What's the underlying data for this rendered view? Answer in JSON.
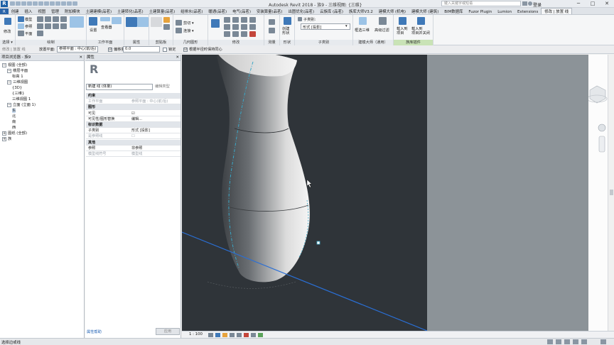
{
  "titlebar": {
    "logo": "R",
    "app_title": "Autodesk Revit 2018 -    族9 - 三维视图: {三维}",
    "search_placeholder": "键入关键字或短语",
    "login": "登录",
    "minimize": "─",
    "maximize": "□",
    "close": "✕"
  },
  "tabs": [
    {
      "label": "R",
      "active": false,
      "file": true
    },
    {
      "label": "创建",
      "active": false
    },
    {
      "label": "插入",
      "active": false
    },
    {
      "label": "视图",
      "active": false
    },
    {
      "label": "管理",
      "active": false
    },
    {
      "label": "附加模块",
      "active": false
    },
    {
      "label": "土建建模(品茗)",
      "active": false
    },
    {
      "label": "土建转化(品茗)",
      "active": false
    },
    {
      "label": "土建算量(品茗)",
      "active": false
    },
    {
      "label": "给排水(品茗)",
      "active": false
    },
    {
      "label": "暖通(品茗)",
      "active": false
    },
    {
      "label": "电气(品茗)",
      "active": false
    },
    {
      "label": "安装算量(品茗)",
      "active": false
    },
    {
      "label": "出图优化(品茗)",
      "active": false
    },
    {
      "label": "云族库 (品茗)",
      "active": false
    },
    {
      "label": "族库大师V3.2",
      "active": false
    },
    {
      "label": "建模大师 (机电)",
      "active": false
    },
    {
      "label": "建模大师 (建筑)",
      "active": false
    },
    {
      "label": "BIM数据库",
      "active": false
    },
    {
      "label": "Fuzor Plugin",
      "active": false
    },
    {
      "label": "Lumion",
      "active": false
    },
    {
      "label": "Extensions",
      "active": false
    },
    {
      "label": "修改 | 放置 线",
      "active": true
    }
  ],
  "ribbon": {
    "groups": {
      "select": "选择 ▾",
      "properties": "属性",
      "clipboard": "剪贴板",
      "geometry": "几何图形",
      "modify": "修改",
      "measure": "测量",
      "create": "创建",
      "form": "形状",
      "subcategory": "子类别",
      "jianmo": "建模大师（通用）",
      "zuku": "族库插件"
    },
    "labels": {
      "modify_btn": "修改",
      "model": "模型",
      "reference": "参照",
      "plane": "平面",
      "draw": "绘制",
      "set": "设置",
      "viewer": "查看器",
      "workplane": "工作平面",
      "cut": "剪切 ▾",
      "join": "连接 ▾",
      "create_form": "创建\n形状",
      "subcategory_label": "子类别:",
      "subcategory_value": "形式 [投影]",
      "filter3d": "框选三维",
      "advfilter": "高级过滤",
      "load_project": "载入到\n项目",
      "load_close": "载入到\n项目并关闭"
    }
  },
  "optbar": {
    "mode": "修改 | 放置 线",
    "plane_label": "放置平面:",
    "plane_value": "参照平面 : 中心(前/后)",
    "offset_label": "偏移量:",
    "offset_value": "0.0",
    "lock_label": "锁定",
    "chain_label": "链",
    "radius_label": "根据半径时保持同心"
  },
  "browser": {
    "title": "项目浏览器 - 族9",
    "items": [
      {
        "label": "视图 (全部)",
        "indent": 0,
        "exp": "−"
      },
      {
        "label": "楼层平面",
        "indent": 1,
        "exp": "−"
      },
      {
        "label": "标高 1",
        "indent": 2,
        "exp": ""
      },
      {
        "label": "三维视图",
        "indent": 1,
        "exp": "−"
      },
      {
        "label": "{3D}",
        "indent": 2,
        "exp": ""
      },
      {
        "label": "{三维}",
        "indent": 2,
        "exp": ""
      },
      {
        "label": "三维视图 1",
        "indent": 2,
        "exp": ""
      },
      {
        "label": "立面 (立面 1)",
        "indent": 1,
        "exp": "−"
      },
      {
        "label": "东",
        "indent": 2,
        "exp": "",
        "selected": true
      },
      {
        "label": "北",
        "indent": 2,
        "exp": ""
      },
      {
        "label": "南",
        "indent": 2,
        "exp": ""
      },
      {
        "label": "西",
        "indent": 2,
        "exp": ""
      },
      {
        "label": "图纸 (全部)",
        "indent": 0,
        "exp": "+"
      },
      {
        "label": "族",
        "indent": 0,
        "exp": "+"
      }
    ]
  },
  "properties": {
    "title": "属性",
    "logo": "R",
    "type_selector": "新建 线 (体量)",
    "edit_type": "编辑类型",
    "rows": [
      {
        "k": "约束",
        "v": "",
        "cat": true
      },
      {
        "k": "工作平面",
        "v": "参照平面 : 中心(前/后)",
        "grey": true
      },
      {
        "k": "图形",
        "v": "",
        "cat": true
      },
      {
        "k": "可见",
        "v": "☑"
      },
      {
        "k": "可见性/图形替换",
        "v": "编辑..."
      },
      {
        "k": "标识数据",
        "v": "",
        "cat": true
      },
      {
        "k": "子类别",
        "v": "形式 [投影]"
      },
      {
        "k": "是参照线",
        "v": "☐",
        "grey": true
      },
      {
        "k": "其他",
        "v": "",
        "cat": true
      },
      {
        "k": "参照",
        "v": "非参照"
      },
      {
        "k": "模型线符号",
        "v": "模型线",
        "grey": true
      }
    ],
    "help": "属性帮助",
    "apply": "应用"
  },
  "viewbar": {
    "scale": "1 : 100"
  },
  "statusbar": {
    "text": "选择边或线"
  },
  "colors": {
    "viewport_bg": "#2f3439",
    "vase_light": "#f2f2f2",
    "vase_dark": "#2e3236",
    "selection_line": "#3aa7c7",
    "blue_edge": "#2a6fd6",
    "gray_panel": "#8c9398"
  }
}
